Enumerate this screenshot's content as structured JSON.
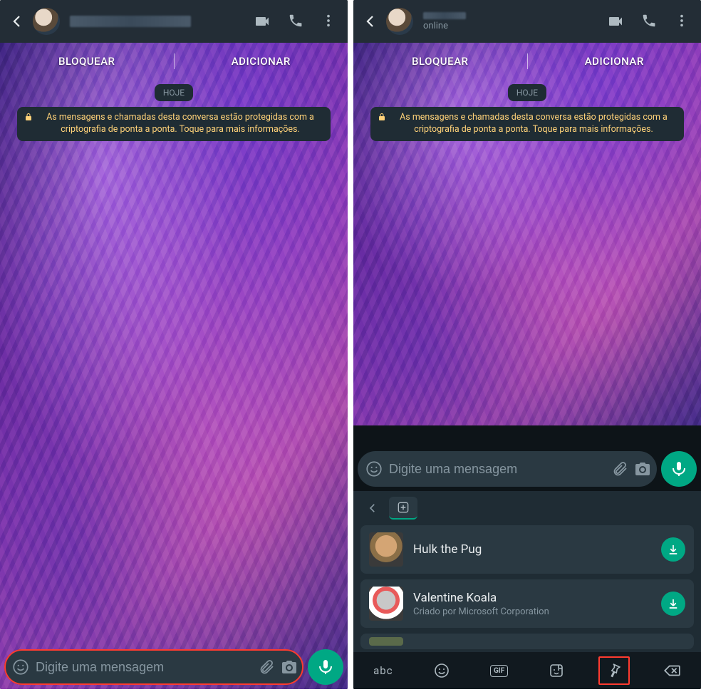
{
  "left": {
    "header": {
      "status": "",
      "actions": {
        "video": "video-icon",
        "call": "call-icon",
        "more": "more-icon"
      }
    },
    "block_bar": {
      "block": "BLOQUEAR",
      "add": "ADICIONAR"
    },
    "date_chip": "HOJE",
    "encryption": "As mensagens e chamadas desta conversa estão protegidas com a criptografia de ponta a ponta. Toque para mais informações.",
    "input": {
      "placeholder": "Digite uma mensagem"
    }
  },
  "right": {
    "header": {
      "status": "online"
    },
    "block_bar": {
      "block": "BLOQUEAR",
      "add": "ADICIONAR"
    },
    "date_chip": "HOJE",
    "encryption": "As mensagens e chamadas desta conversa estão protegidas com a criptografia de ponta a ponta. Toque para mais informações.",
    "input": {
      "placeholder": "Digite uma mensagem"
    },
    "sticker_packs": [
      {
        "name": "Hulk the Pug",
        "author": ""
      },
      {
        "name": "Valentine Koala",
        "author": "Criado por Microsoft Corporation"
      }
    ],
    "keyboard": {
      "abc": "abc"
    }
  }
}
